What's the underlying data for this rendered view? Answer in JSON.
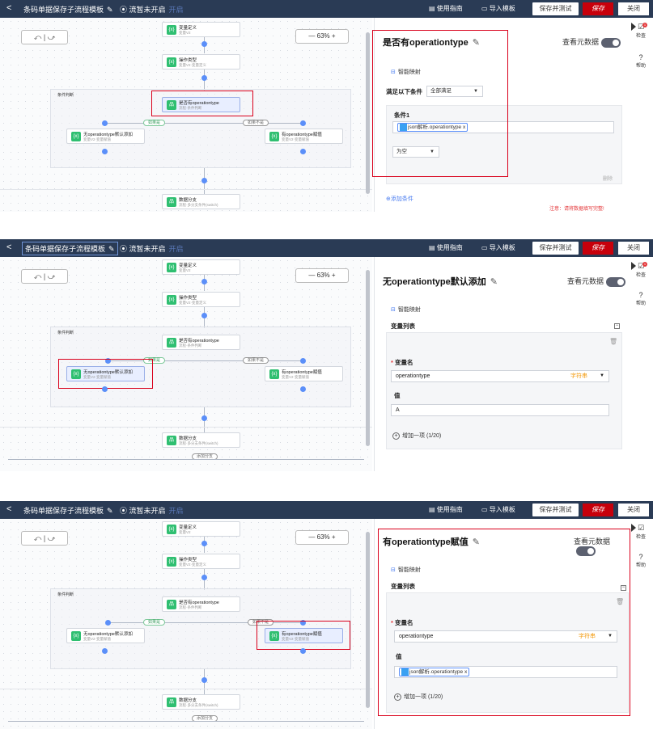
{
  "topbar": {
    "back": "<",
    "title": "条码单据保存子流程模板",
    "flow_status": "流暂未开启",
    "flow_open": "开启",
    "guide": "使用指南",
    "import": "导入模板",
    "save_test": "保存并测试",
    "save": "保存",
    "close": "关闭"
  },
  "canvas": {
    "undo_redo": "⤺ | ⤻",
    "zoom": "—   63%   +",
    "group_label": "条件判断",
    "nodes": {
      "var_def": {
        "title": "变量定义",
        "sub": "变量V2"
      },
      "op_type": {
        "title": "操作类型",
        "sub": "变量V2·变量定义"
      },
      "has_op": {
        "title": "是否有operationtype",
        "sub": "流程·条件判断"
      },
      "no_op": {
        "title": "无operationtype默认添加",
        "sub": "变量V2·变量赋值"
      },
      "yes_op": {
        "title": "有operationtype赋值",
        "sub": "变量V2·变量赋值"
      },
      "data_branch": {
        "title": "数据分支",
        "sub": "流程·多分支条件(switch)"
      }
    },
    "tags": {
      "yes": "如果是",
      "no": "如果不是",
      "add_branch": "添加分支"
    }
  },
  "panel1": {
    "title": "是否有operationtype",
    "view_meta": "查看元数据",
    "smart_map": "智能映射",
    "cond_label": "满足以下条件",
    "cond_select": "全部满足",
    "cond1": "条件1",
    "chip": "json解析.operationtype",
    "chip_x": "x",
    "op_select": "为空",
    "delete": "删除",
    "add_cond": "⊕添加条件",
    "warn": "注意：请将数据填写完整!"
  },
  "panel2": {
    "title": "无operationtype默认添加",
    "view_meta": "查看元数据",
    "smart_map": "智能映射",
    "var_list": "变量列表",
    "var_name_label": "变量名",
    "var_name": "operationtype",
    "var_type": "字符串",
    "value_label": "值",
    "value": "A",
    "add_item": "增加一项 (1/20)"
  },
  "panel3": {
    "title": "有operationtype赋值",
    "view_meta": "查看元数据",
    "smart_map": "智能映射",
    "var_list": "变量列表",
    "var_name_label": "变量名",
    "var_name": "operationtype",
    "var_type": "字符串",
    "value_label": "值",
    "chip": "json解析.operationtype",
    "chip_x": "x",
    "add_item": "增加一项 (1/20)"
  },
  "side": {
    "check": "检查",
    "help": "帮助"
  },
  "colors": {
    "topbar": "#2a3b55",
    "save": "#c7000b",
    "highlight": "#d9001b",
    "node_icon": "#2fbf71",
    "dot": "#5b8ff9"
  }
}
